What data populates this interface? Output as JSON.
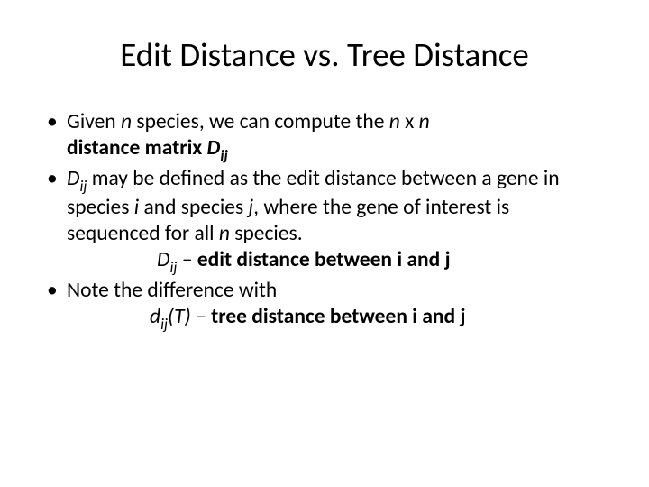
{
  "title": "Edit Distance vs. Tree Distance",
  "b1": {
    "p1": "Given ",
    "p2": "n",
    "p3": " species, we can compute the ",
    "p4": "n",
    "p5": " x ",
    "p6": "n",
    "p7": "distance matrix ",
    "p8": "D",
    "p9": "ij"
  },
  "b2": {
    "p1": "D",
    "p2": "ij",
    "p3": " may be defined as the edit distance between a gene in species ",
    "p4": "i",
    "p5": " and species ",
    "p6": "j",
    "p7": ", where the gene of interest is sequenced for all ",
    "p8": "n",
    "p9": " species."
  },
  "b2def": {
    "p1": "D",
    "p2": "ij",
    "p3": " – ",
    "p4": "edit distance between i and j"
  },
  "b3": {
    "p1": "Note the difference with"
  },
  "b3def": {
    "p1": "d",
    "p2": "ij",
    "p3": "(T) ",
    "p4": "– ",
    "p5": "tree distance between i and j"
  }
}
